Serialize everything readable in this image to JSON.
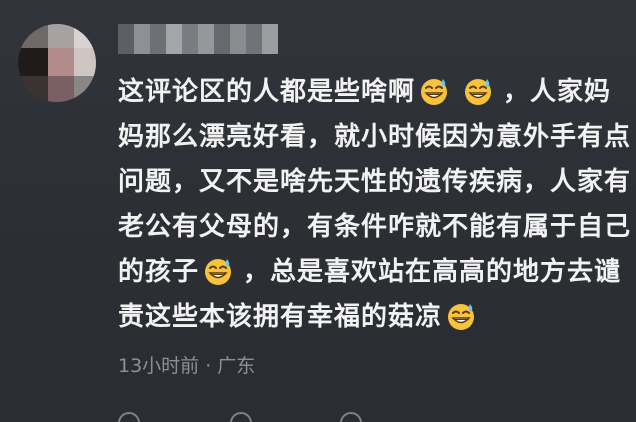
{
  "comment": {
    "author_name": "",
    "lines": [
      [
        "这评论区的人都是些啥啊",
        "[emoji]",
        "[emoji]",
        "，人家妈"
      ],
      [
        "妈那么漂亮好看，就小时候因为意外手有点"
      ],
      [
        "问题，又不是啥先天性的遗传疾病，人家有"
      ],
      [
        "老公有父母的，有条件咋就不能有属于自己"
      ],
      [
        "的孩子",
        "[emoji]",
        "，总是喜欢站在高高的地方去谴"
      ],
      [
        "责这些本该拥有幸福的菇凉",
        "[emoji]"
      ]
    ],
    "emoji_name": "grinning-sweat-emoji",
    "meta": "13小时前 · 广东"
  },
  "actions": {
    "reply_label": "",
    "share_label": "",
    "like_label": ""
  },
  "colors": {
    "background": "#2b2e33",
    "text": "#f2f2f2",
    "meta": "#8d9097",
    "emoji_face": "#f6c33b",
    "sweat": "#6fc3f0"
  }
}
